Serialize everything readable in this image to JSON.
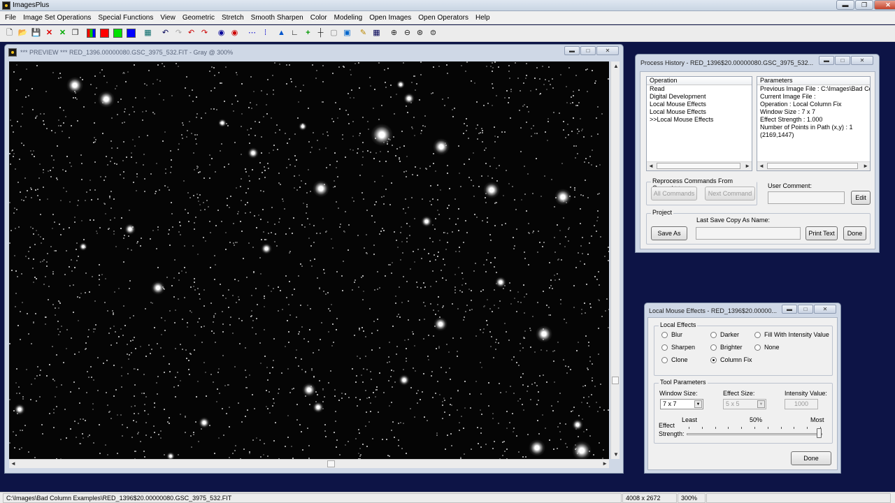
{
  "app": {
    "title": "ImagesPlus"
  },
  "menu": [
    "File",
    "Image Set Operations",
    "Special Functions",
    "View",
    "Geometric",
    "Stretch",
    "Smooth Sharpen",
    "Color",
    "Modeling",
    "Open Images",
    "Open Operators",
    "Help"
  ],
  "toolbar": {
    "icons": [
      "new-icon",
      "open-icon",
      "save-icon",
      "close-red-icon",
      "close-green-icon",
      "copy-icon",
      "rgb-channels-icon",
      "red-channel-icon",
      "green-channel-icon",
      "blue-channel-icon",
      "grid-icon",
      "undo-icon",
      "redo-icon",
      "undo-all-icon",
      "redo-all-icon",
      "dot-icon",
      "dot-red-icon",
      "points-icon",
      "path-icon",
      "histogram-icon",
      "levels-icon",
      "plus-icon",
      "crosshair-icon",
      "frame-icon",
      "picture-icon",
      "pencil-icon",
      "table-icon",
      "zoom-in-icon",
      "zoom-out-icon",
      "zoom-fit-icon",
      "zoom-actual-icon"
    ],
    "channel_colors": {
      "red": "#ff0000",
      "green": "#00e000",
      "blue": "#0000ff"
    }
  },
  "image_window": {
    "title": "*** PREVIEW *** RED_1396.00000080.GSC_3975_532.FIT - Gray @ 300%",
    "buttons": {
      "minimize": "▬",
      "maximize": "□",
      "close": "✕"
    }
  },
  "process_history": {
    "title": "Process History - RED_1396$20.00000080.GSC_3975_532...",
    "operation_header": "Operation",
    "operations": [
      "Read",
      "Digital Development",
      "Local Mouse Effects",
      "Local Mouse Effects",
      ">>Local Mouse Effects"
    ],
    "parameters_header": "Parameters",
    "parameters": [
      "Previous Image File : C:\\Images\\Bad Co...",
      "Current Image File :",
      "Operation : Local Column Fix",
      "Window Size : 7 x 7",
      "Effect Strength : 1.000",
      "Number of Points in Path (x,y) : 1",
      "(2169,1447)"
    ],
    "reprocess_label": "Reprocess Commands From Current >>",
    "all_commands": "All Commands",
    "next_command": "Next Command",
    "user_comment_label": "User Comment:",
    "edit": "Edit",
    "project_label": "Project",
    "last_save_label": "Last Save Copy As Name:",
    "save_as": "Save As",
    "print_text": "Print Text",
    "done": "Done"
  },
  "local_effects": {
    "title": "Local Mouse Effects - RED_1396$20.00000...",
    "group_label": "Local Effects",
    "options": [
      {
        "label": "Blur",
        "checked": false
      },
      {
        "label": "Darker",
        "checked": false
      },
      {
        "label": "Fill With Intensity Value",
        "checked": false
      },
      {
        "label": "Sharpen",
        "checked": false
      },
      {
        "label": "Brighter",
        "checked": false
      },
      {
        "label": "None",
        "checked": false
      },
      {
        "label": "Clone",
        "checked": false
      },
      {
        "label": "Column Fix",
        "checked": true
      }
    ],
    "tool_params_label": "Tool Parameters",
    "window_size_label": "Window Size:",
    "window_size": "7 x 7",
    "effect_size_label": "Effect Size:",
    "effect_size": "5 x 5",
    "intensity_label": "Intensity Value:",
    "intensity": "1000",
    "least": "Least",
    "mid": "50%",
    "most": "Most",
    "strength_label_1": "Effect",
    "strength_label_2": "Strength:",
    "strength_fraction": 1.0,
    "done": "Done"
  },
  "status": {
    "path": "C:\\Images\\Bad Column Examples\\RED_1396$20.00000080.GSC_3975_532.FIT",
    "dimensions": "4008 x 2672",
    "zoom": "300%"
  }
}
